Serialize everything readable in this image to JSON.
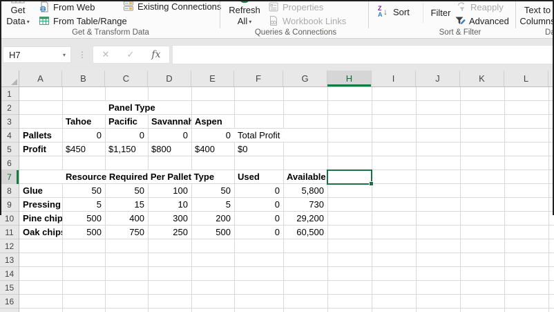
{
  "ribbon": {
    "get_data": {
      "line1": "Get",
      "line2": "Data"
    },
    "from_web": "From Web",
    "from_table_range": "From Table/Range",
    "existing_connections": "Existing Connections",
    "group_get_transform": "Get & Transform Data",
    "refresh_all": {
      "line1": "Refresh",
      "line2": "All"
    },
    "properties": "Properties",
    "workbook_links": "Workbook Links",
    "group_queries": "Queries & Connections",
    "sort": "Sort",
    "filter": "Filter",
    "reapply": "Reapply",
    "advanced": "Advanced",
    "group_sort_filter": "Sort & Filter",
    "text_to_columns": {
      "line1": "Text to",
      "line2": "Columns"
    },
    "group_data_tools": "Data Tools"
  },
  "formula_bar": {
    "name_box": "H7",
    "formula": "",
    "fx_label": "fx",
    "cancel_glyph": "✕",
    "enter_glyph": "✓",
    "handle_glyph": "⋮"
  },
  "icons": {
    "caret": "▾",
    "sort_z": "Z",
    "sort_a": "A",
    "sort_arrow": "↓"
  },
  "sheet": {
    "selected_cell": "H7",
    "col_headers": [
      "A",
      "B",
      "C",
      "D",
      "E",
      "F",
      "G",
      "H",
      "I",
      "J",
      "K",
      "L"
    ],
    "row_headers": [
      "1",
      "2",
      "3",
      "4",
      "5",
      "6",
      "7",
      "8",
      "9",
      "10",
      "11",
      "12",
      "13",
      "14",
      "15",
      "16"
    ],
    "cells": {
      "C2": "Panel Type",
      "B3": "Tahoe",
      "C3": "Pacific",
      "D3": "Savannah",
      "E3": "Aspen",
      "A4": "Pallets",
      "B4": "0",
      "C4": "0",
      "D4": "0",
      "E4": "0",
      "F4": "Total Profit",
      "A5": "Profit",
      "B5": "$450",
      "C5": "$1,150",
      "D5": "$800",
      "E5": "$400",
      "F5": "$0",
      "B7": "Resource Required Per Pallet Type",
      "F7": "Used",
      "G7": "Available",
      "A8": "Glue",
      "B8": "50",
      "C8": "50",
      "D8": "100",
      "E8": "50",
      "F8": "0",
      "G8": "5,800",
      "A9": "Pressing",
      "B9": "5",
      "C9": "15",
      "D9": "10",
      "E9": "5",
      "F9": "0",
      "G9": "730",
      "A10": "Pine chips",
      "B10": "500",
      "C10": "400",
      "D10": "300",
      "E10": "200",
      "F10": "0",
      "G10": "29,200",
      "A11": "Oak chips",
      "B11": "500",
      "C11": "750",
      "D11": "250",
      "E11": "500",
      "F11": "0",
      "G11": "60,500"
    }
  },
  "colors": {
    "accent_green": "#107c41",
    "header_bg": "#e8e8e8",
    "selected_header_bg": "#d6d6d6",
    "gridline": "#d9d9d9",
    "disabled_text": "#ababab",
    "sort_z_purple": "#7719aa",
    "sort_a_blue": "#2b7cd3"
  }
}
